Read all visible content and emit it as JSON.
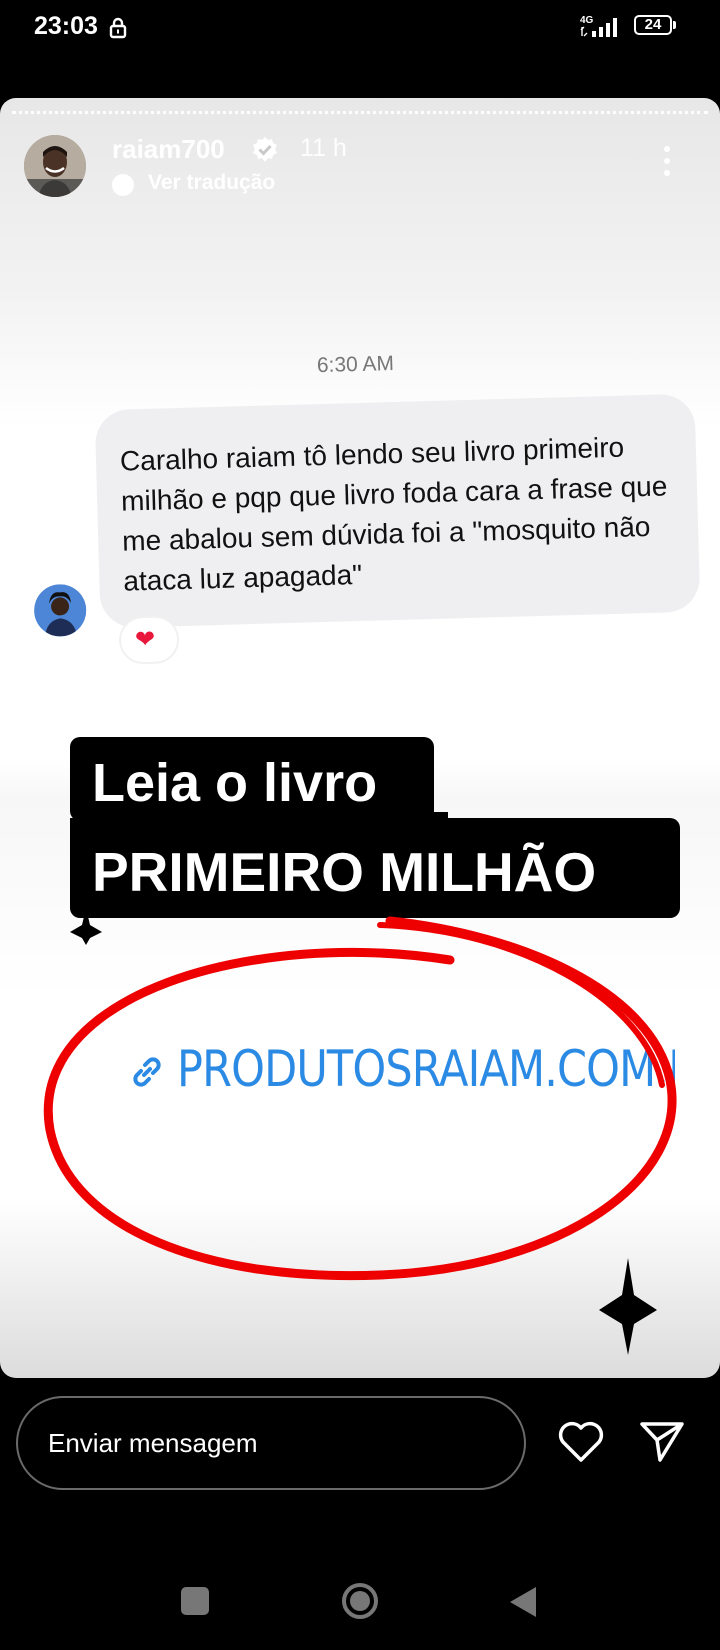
{
  "status_bar": {
    "time": "23:03",
    "network": "4G",
    "battery": "24"
  },
  "story": {
    "username": "raiam700",
    "time_ago": "11 h",
    "translate_label": "Ver tradução",
    "screenshot": {
      "timestamp": "6:30 AM",
      "message": "Caralho raiam tô lendo seu livro primeiro milhão e pqp que livro foda cara a frase que me abalou sem dúvida foi a \"mosquito não ataca luz apagada\"",
      "reaction": "❤"
    },
    "label_line1": "Leia o livro",
    "label_line2": "PRIMEIRO MILHÃO",
    "link_text": "PRODUTOSRAIAM.COM.BR"
  },
  "bottom_bar": {
    "message_placeholder": "Enviar mensagem"
  },
  "icons": [
    "lock-icon",
    "verified-icon",
    "translate-icon",
    "more-options-icon",
    "link-icon",
    "heart-icon",
    "send-icon",
    "recents-icon",
    "home-icon",
    "back-icon"
  ],
  "colors": {
    "link": "#2b8ae3",
    "annotation_circle": "#ee0000",
    "reaction_heart": "#e8173b"
  }
}
